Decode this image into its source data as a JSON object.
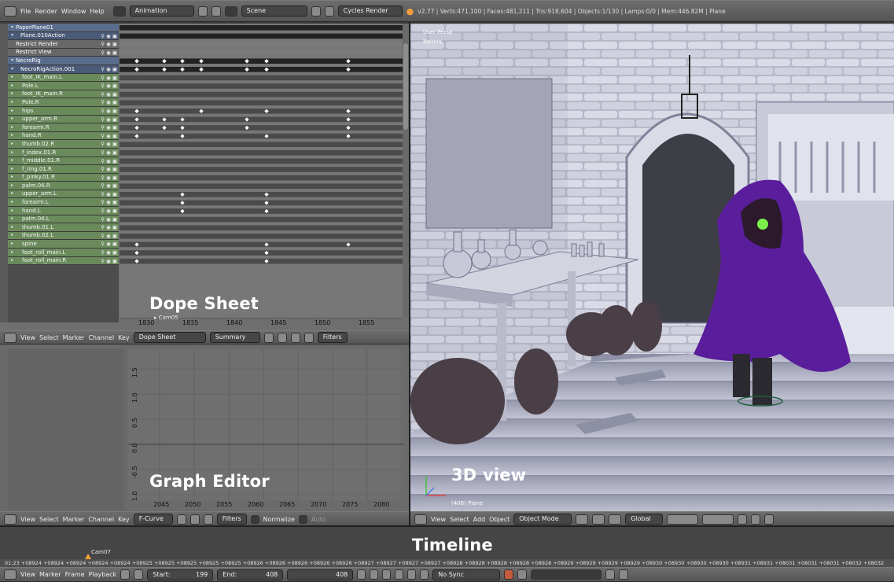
{
  "topbar": {
    "menus": [
      "File",
      "Render",
      "Window",
      "Help"
    ],
    "screen_layout": "Animation",
    "scene": "Scene",
    "render_engine": "Cycles Render",
    "stats": "v2.77 | Verts:471,100 | Faces:481,211 | Tris:918,604 | Objects:1/130 | Lamps:0/0 | Mem:446.82M | Plane"
  },
  "dopesheet": {
    "overlay_title": "Dope Sheet",
    "channels": [
      {
        "label": "PaperPlane01",
        "kind": "obj"
      },
      {
        "label": "Plane.010Action",
        "kind": "act"
      },
      {
        "label": "Restrict Render",
        "kind": "gray"
      },
      {
        "label": "Restrict View",
        "kind": "gray"
      },
      {
        "label": "NecroRig",
        "kind": "obj"
      },
      {
        "label": "NecroRigAction.001",
        "kind": "act"
      },
      {
        "label": "foot_IK_main.L",
        "kind": "grp"
      },
      {
        "label": "Pole.L",
        "kind": "grp"
      },
      {
        "label": "foot_IK_main.R",
        "kind": "grp"
      },
      {
        "label": "Pole.R",
        "kind": "grp"
      },
      {
        "label": "hips",
        "kind": "grp"
      },
      {
        "label": "upper_arm.R",
        "kind": "grp"
      },
      {
        "label": "forearm.R",
        "kind": "grp"
      },
      {
        "label": "hand.R",
        "kind": "grp"
      },
      {
        "label": "thumb.02.R",
        "kind": "grp"
      },
      {
        "label": "f_index.01.R",
        "kind": "grp"
      },
      {
        "label": "f_middle.01.R",
        "kind": "grp"
      },
      {
        "label": "f_ring.01.R",
        "kind": "grp"
      },
      {
        "label": "f_pinky.01.R",
        "kind": "grp"
      },
      {
        "label": "palm.04.R",
        "kind": "grp"
      },
      {
        "label": "upper_arm.L",
        "kind": "grp"
      },
      {
        "label": "forearm.L",
        "kind": "grp"
      },
      {
        "label": "hand.L",
        "kind": "grp"
      },
      {
        "label": "palm.04.L",
        "kind": "grp"
      },
      {
        "label": "thumb.01.L",
        "kind": "grp"
      },
      {
        "label": "thumb.02.L",
        "kind": "grp"
      },
      {
        "label": "spine",
        "kind": "grp"
      },
      {
        "label": "foot_roll_main.L",
        "kind": "grp"
      },
      {
        "label": "foot_roll_main.R",
        "kind": "grp"
      }
    ],
    "ruler_labels": [
      "1830",
      "1835",
      "1840",
      "1845",
      "1850",
      "1855"
    ],
    "marker_label": "Cam05",
    "header": {
      "menus": [
        "View",
        "Select",
        "Marker",
        "Channel",
        "Key"
      ],
      "mode": "Dope Sheet",
      "summary": "Summary",
      "filters": "Filters"
    }
  },
  "graph_editor": {
    "overlay_title": "Graph Editor",
    "y_labels": [
      "1.5",
      "1.0",
      "0.5",
      "0.0",
      "-0.5",
      "-1.0"
    ],
    "x_labels": [
      "2045",
      "2050",
      "2055",
      "2060",
      "2065",
      "2070",
      "2075",
      "2080"
    ],
    "header": {
      "menus": [
        "View",
        "Select",
        "Marker",
        "Channel",
        "Key"
      ],
      "mode": "F-Curve",
      "filters": "Filters",
      "normalize": "Normalize",
      "auto": "Auto"
    }
  },
  "view3d": {
    "overlay_title": "3D view",
    "view_label": "User Persp",
    "units_label": "Meters",
    "object_label": "(408) Plane",
    "header": {
      "menus": [
        "View",
        "Select",
        "Add",
        "Object"
      ],
      "mode": "Object Mode",
      "orientation": "Global"
    }
  },
  "timeline": {
    "overlay_title": "Timeline",
    "marker_label": "Cam07",
    "ruler_text": "01:23 +08924 +08924 +08924 +08924 +08924 +08925 +08925 +08925 +08925 +08925 +08926 +08926 +08926 +08926 +08926 +08927 +08927 +08927 +08927 +08928 +08928 +08928 +08928 +08928 +08929 +08929 +08929 +08929 +08930 +08930 +08930 +08930 +08931 +08931 +08031 +08031 +08031 +08032 +08032",
    "header": {
      "menus": [
        "View",
        "Marker",
        "Frame",
        "Playback"
      ],
      "start": "Start:",
      "start_value": "199",
      "end": "End:",
      "end_value": "408",
      "current": "408",
      "sync": "No Sync"
    }
  },
  "colors": {
    "header": "#5d5d5d",
    "group_channel": "#6a8a5c",
    "object_channel": "#5a6c8c",
    "keyframe": "#ffffff",
    "viewport_bg": "#9ea0b6",
    "cloak": "#5a1d9c"
  }
}
